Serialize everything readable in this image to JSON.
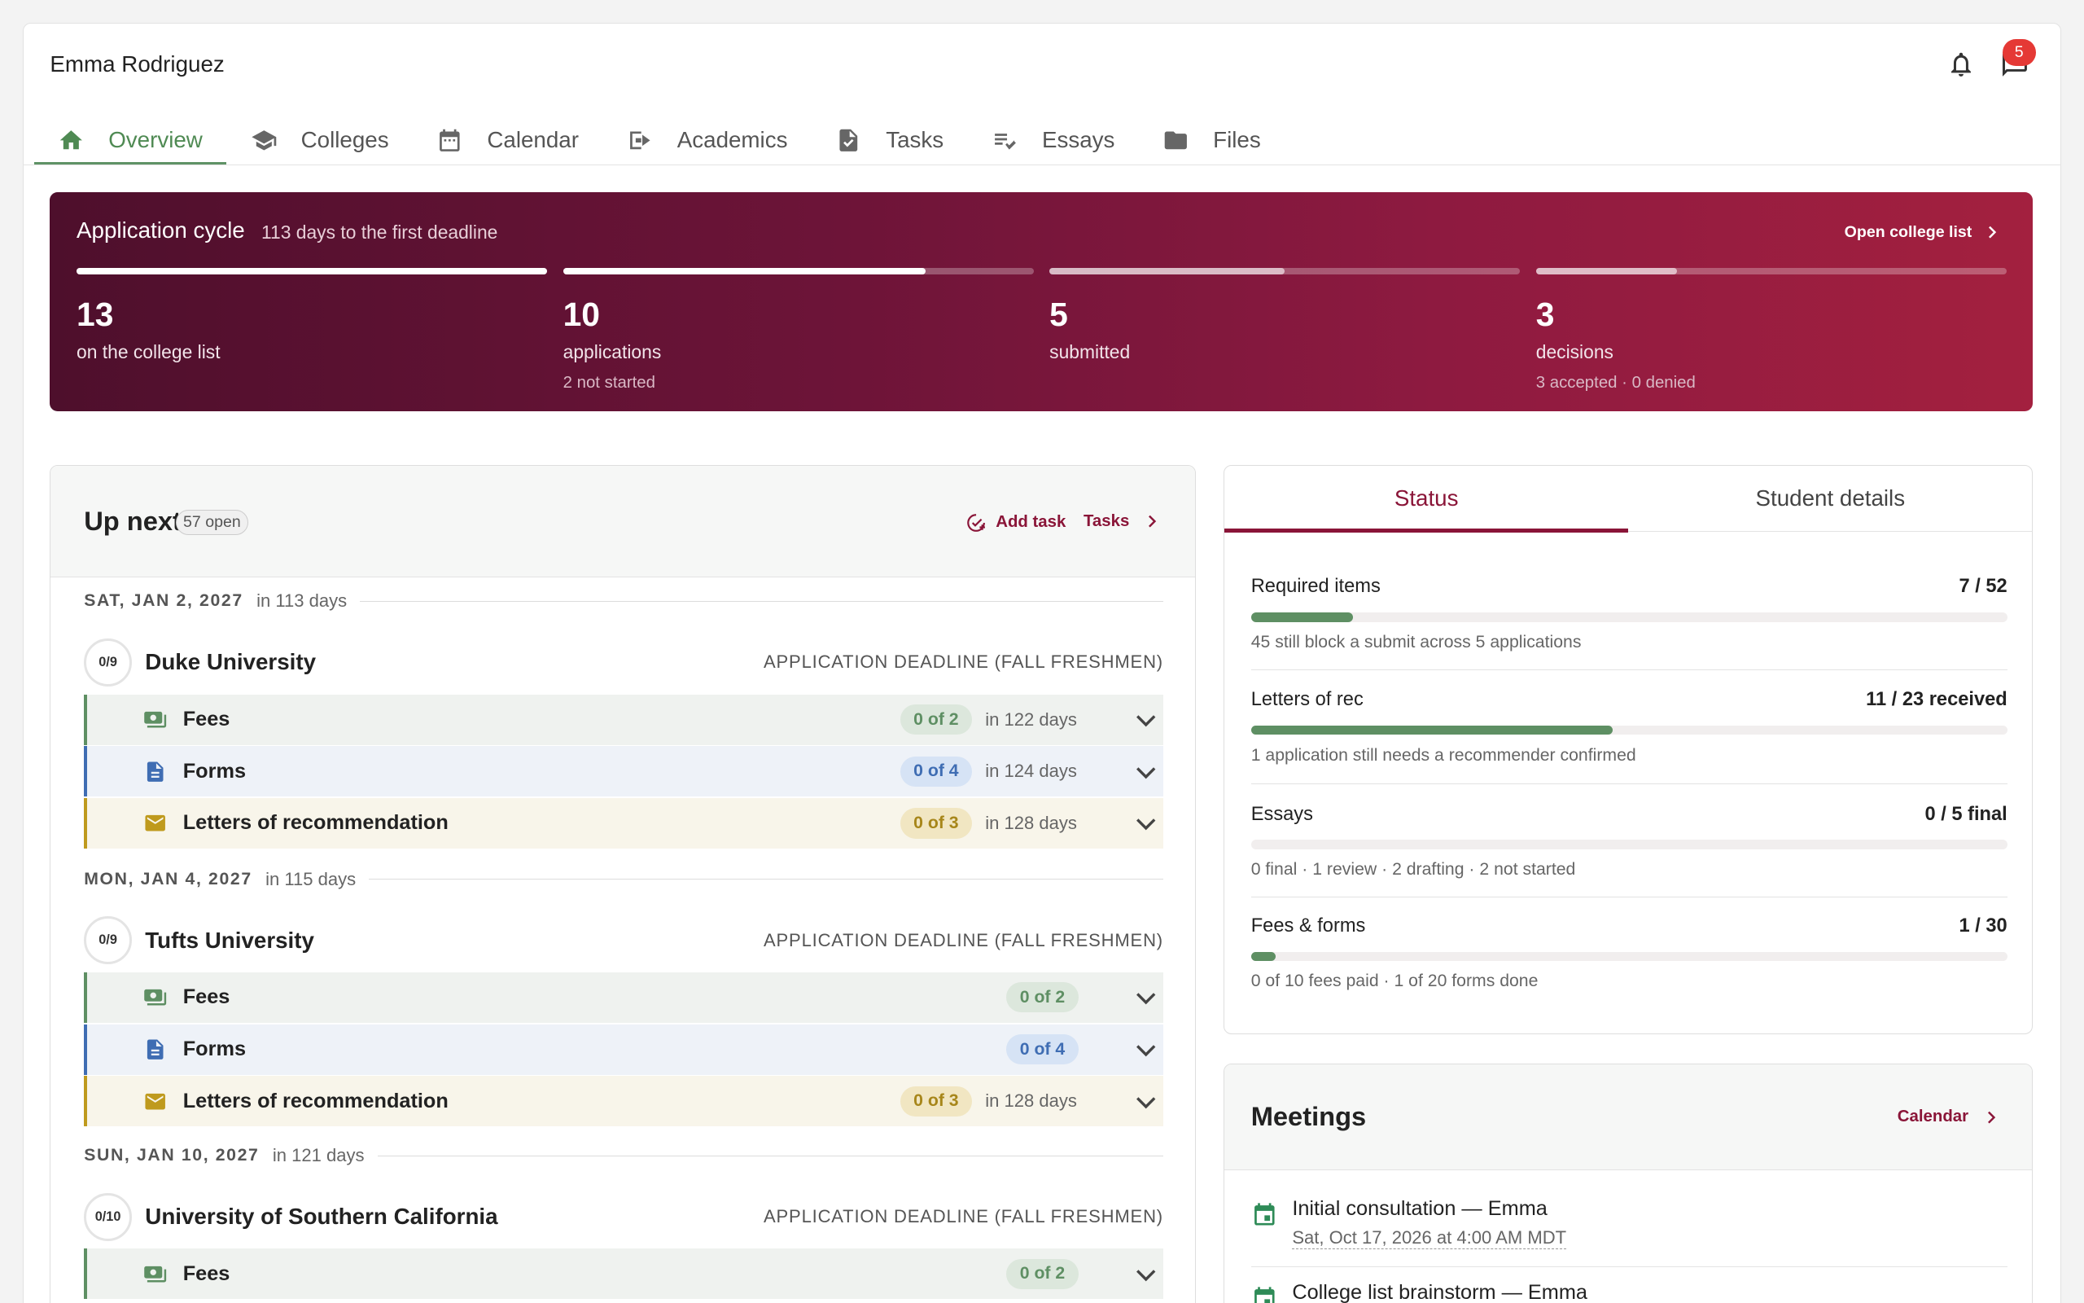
{
  "header": {
    "student_name": "Emma Rodriguez",
    "notification_count": "5"
  },
  "tabs": [
    {
      "label": "Overview",
      "icon": "home-icon",
      "active": true
    },
    {
      "label": "Colleges",
      "icon": "graduation-cap-icon"
    },
    {
      "label": "Calendar",
      "icon": "calendar-icon"
    },
    {
      "label": "Academics",
      "icon": "academics-icon"
    },
    {
      "label": "Tasks",
      "icon": "task-doc-icon"
    },
    {
      "label": "Essays",
      "icon": "edit-list-icon"
    },
    {
      "label": "Files",
      "icon": "folder-icon"
    }
  ],
  "cycle": {
    "title": "Application cycle",
    "subtitle": "113 days to the first deadline",
    "link": "Open college list",
    "stats": [
      {
        "value": "13",
        "label": "on the college list",
        "note": "",
        "progress": 1.0
      },
      {
        "value": "10",
        "label": "applications",
        "note": "2 not started",
        "progress": 0.77
      },
      {
        "value": "5",
        "label": "submitted",
        "note": "",
        "progress": 0.5
      },
      {
        "value": "3",
        "label": "decisions",
        "note": "3 accepted · 0 denied",
        "progress": 0.3
      }
    ]
  },
  "upnext": {
    "title": "Up next",
    "open_count": "57 open",
    "add_task": "Add task",
    "tasks_link": "Tasks",
    "groups": [
      {
        "date": "SAT, JAN 2, 2027",
        "relative": "in 113 days",
        "college": "Duke University",
        "progress": "0/9",
        "deadline": "APPLICATION DEADLINE (FALL FRESHMEN)",
        "items": [
          {
            "type": "fees",
            "label": "Fees",
            "count": "0 of 2",
            "due": "in 122 days"
          },
          {
            "type": "forms",
            "label": "Forms",
            "count": "0 of 4",
            "due": "in 124 days"
          },
          {
            "type": "letters",
            "label": "Letters of recommendation",
            "count": "0 of 3",
            "due": "in 128 days"
          }
        ]
      },
      {
        "date": "MON, JAN 4, 2027",
        "relative": "in 115 days",
        "college": "Tufts University",
        "progress": "0/9",
        "deadline": "APPLICATION DEADLINE (FALL FRESHMEN)",
        "items": [
          {
            "type": "fees",
            "label": "Fees",
            "count": "0 of 2",
            "due": ""
          },
          {
            "type": "forms",
            "label": "Forms",
            "count": "0 of 4",
            "due": ""
          },
          {
            "type": "letters",
            "label": "Letters of recommendation",
            "count": "0 of 3",
            "due": "in 128 days"
          }
        ]
      },
      {
        "date": "SUN, JAN 10, 2027",
        "relative": "in 121 days",
        "college": "University of Southern California",
        "progress": "0/10",
        "deadline": "APPLICATION DEADLINE (FALL FRESHMEN)",
        "items": [
          {
            "type": "fees",
            "label": "Fees",
            "count": "0 of 2",
            "due": ""
          }
        ]
      }
    ]
  },
  "status": {
    "tabs": [
      "Status",
      "Student details"
    ],
    "metrics": [
      {
        "label": "Required items",
        "value": "7 / 52",
        "note": "45 still block a submit across 5 applications",
        "progress": 0.135
      },
      {
        "label": "Letters of rec",
        "value": "11 / 23 received",
        "note": "1 application still needs a recommender confirmed",
        "progress": 0.478
      },
      {
        "label": "Essays",
        "value": "0 / 5 final",
        "note": "0 final · 1 review · 2 drafting · 2 not started",
        "progress": 0
      },
      {
        "label": "Fees & forms",
        "value": "1 / 30",
        "note": "0 of 10 fees paid · 1 of 20 forms done",
        "progress": 0.033
      }
    ]
  },
  "meetings": {
    "title": "Meetings",
    "link": "Calendar",
    "items": [
      {
        "name": "Initial consultation — Emma",
        "time": "Sat, Oct 17, 2026 at 4:00 AM MDT"
      },
      {
        "name": "College list brainstorm — Emma",
        "time": ""
      }
    ]
  },
  "colors": {
    "accent": "#8a1538",
    "green": "#5e8f63",
    "blue": "#3f6db3",
    "gold": "#bf9a1d"
  }
}
